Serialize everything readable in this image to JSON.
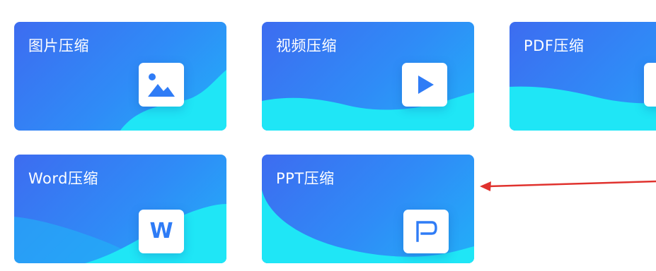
{
  "cards": [
    {
      "id": "image",
      "title": "图片压缩",
      "icon": "image-icon"
    },
    {
      "id": "video",
      "title": "视频压缩",
      "icon": "play-icon"
    },
    {
      "id": "pdf",
      "title": "PDF压缩",
      "icon": "pdf-icon"
    },
    {
      "id": "word",
      "title": "Word压缩",
      "icon": "word-icon",
      "icon_letter": "W"
    },
    {
      "id": "ppt",
      "title": "PPT压缩",
      "icon": "ppt-icon"
    }
  ],
  "colors": {
    "card_gradient_start": "#3d6cf0",
    "card_gradient_end": "#22b0f8",
    "wave": "#1fe0f5",
    "icon_accent": "#2f7cf6",
    "annotation_arrow": "#e0322e"
  },
  "annotation": {
    "type": "arrow",
    "points_to": "ppt"
  }
}
